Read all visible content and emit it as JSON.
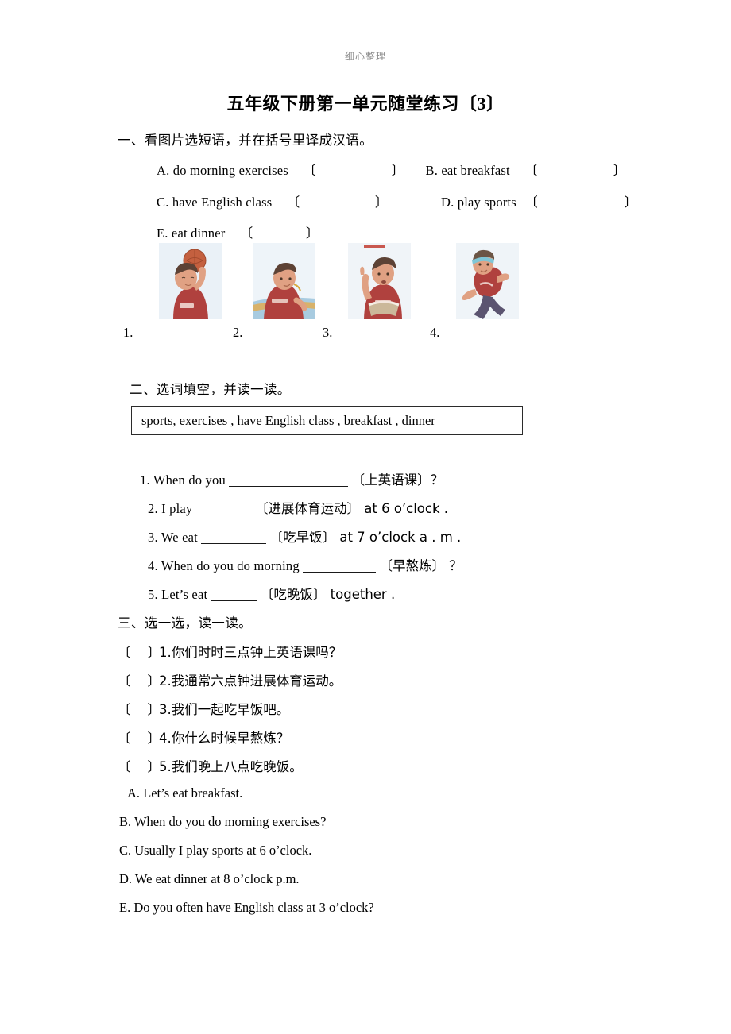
{
  "header": {
    "running_head": "细心整理"
  },
  "title": "五年级下册第一单元随堂练习〔3〕",
  "section1": {
    "heading": "一、看图片选短语，并在括号里译成汉语。",
    "options": [
      {
        "label": "A. do morning exercises",
        "open": "〔",
        "close": "〕"
      },
      {
        "label": "B. eat breakfast",
        "open": "〔",
        "close": "〕"
      },
      {
        "label": "C. have English class",
        "open": "〔",
        "close": "〕"
      },
      {
        "label": "D. play sports",
        "open": "〔",
        "close": "〕"
      },
      {
        "label": "E. eat dinner",
        "open": "〔",
        "close": "〕"
      }
    ],
    "pictures": [
      {
        "alt": "boy-holding-basketball"
      },
      {
        "alt": "boy-eating-at-table"
      },
      {
        "alt": "boy-raising-hand-with-book"
      },
      {
        "alt": "boy-running-with-headband"
      }
    ],
    "answers": [
      {
        "num": "1."
      },
      {
        "num": "2."
      },
      {
        "num": "3."
      },
      {
        "num": "4."
      }
    ]
  },
  "section2": {
    "heading": "二、选词填空，并读一读。",
    "word_bank": "sports,   exercises ,   have English class , breakfast , dinner",
    "questions": [
      {
        "num": "1.",
        "before": "When do you",
        "after": "〔上英语课〕？"
      },
      {
        "num": "2.",
        "before": "I play",
        "after": "〔进展体育运动〕 at 6 o’clock ."
      },
      {
        "num": "3.",
        "before": "We eat",
        "after": "〔吃早饭〕   at 7 o’clock a . m ."
      },
      {
        "num": "4.",
        "before": "When do you do morning",
        "after": "〔早熬炼〕   ？"
      },
      {
        "num": "5.",
        "before": "Let’s eat",
        "after": "〔吃晚饭〕   together ."
      }
    ]
  },
  "section3": {
    "heading": "三、选一选，读一读。",
    "items": [
      {
        "bracket_open": "〔",
        "bracket_close": "〕",
        "text": "1.你们时时三点钟上英语课吗？"
      },
      {
        "bracket_open": "〔",
        "bracket_close": "〕",
        "text": "2.我通常六点钟进展体育运动。"
      },
      {
        "bracket_open": "〔",
        "bracket_close": "〕",
        "text": "3.我们一起吃早饭吧。"
      },
      {
        "bracket_open": "〔",
        "bracket_close": "〕",
        "text": "4.你什么时候早熬炼？"
      },
      {
        "bracket_open": "〔",
        "bracket_close": "〕",
        "text": "5.我们晚上八点吃晚饭。"
      }
    ],
    "options": [
      "A. Let’s eat breakfast.",
      "B. When do you do morning exercises?",
      "C. Usually I play sports at 6 o’clock.",
      "D. We eat dinner at 8 o’clock p.m.",
      "E. Do you often have English class at 3 o’clock?"
    ]
  },
  "colors": {
    "text": "#000000",
    "header_gray": "#8a8a8a",
    "rule": "#2b2b2b",
    "photo_bg": "#eef3f8",
    "shirt_red": "#b0413e",
    "skin": "#e0a183",
    "hair": "#5d4235"
  }
}
